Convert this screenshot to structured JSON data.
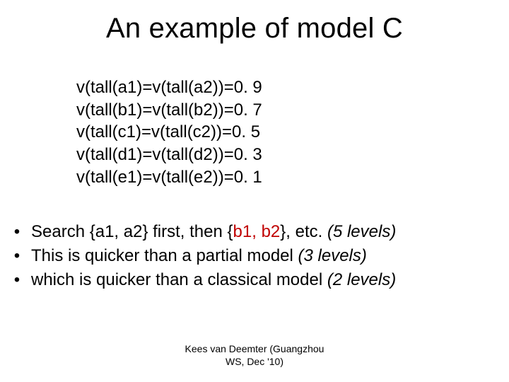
{
  "title": "An example of model C",
  "equations": [
    "v(tall(a1)=v(tall(a2))=0. 9",
    "v(tall(b1)=v(tall(b2))=0. 7",
    "v(tall(c1)=v(tall(c2))=0. 5",
    "v(tall(d1)=v(tall(d2))=0. 3",
    "v(tall(e1)=v(tall(e2))=0. 1"
  ],
  "bullets": [
    {
      "pre": "Search {a1, a2} first, then {",
      "red": "b1, b2",
      "mid": "}, etc.  ",
      "ital": "(5 levels)"
    },
    {
      "pre": "This is quicker than a partial model ",
      "ital": "(3 levels)"
    },
    {
      "pre": "which is quicker than a classical model ",
      "ital": "(2 levels)"
    }
  ],
  "footer": {
    "line1": "Kees van Deemter (Guangzhou",
    "line2": "WS, Dec '10)"
  }
}
